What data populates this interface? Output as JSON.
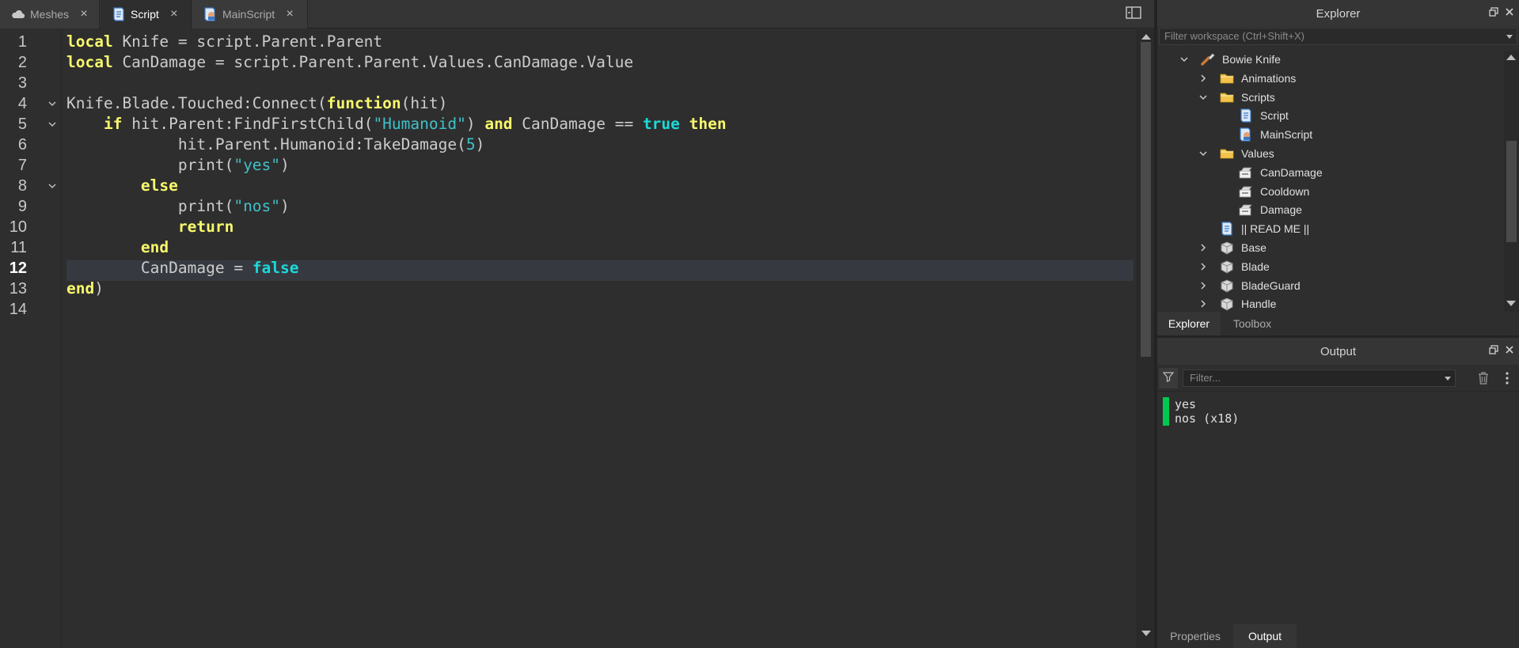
{
  "tabs": [
    {
      "label": "Meshes",
      "icon": "cloud-icon"
    },
    {
      "label": "Script",
      "icon": "script-icon"
    },
    {
      "label": "MainScript",
      "icon": "local-script-icon"
    }
  ],
  "editor": {
    "line_numbers": [
      "1",
      "2",
      "3",
      "4",
      "5",
      "6",
      "7",
      "8",
      "9",
      "10",
      "11",
      "12",
      "13",
      "14"
    ],
    "current_line": 12,
    "lines": [
      "local Knife = script.Parent.Parent",
      "local CanDamage = script.Parent.Parent.Values.CanDamage.Value",
      "",
      "Knife.Blade.Touched:Connect(function(hit)",
      "    if hit.Parent:FindFirstChild(\"Humanoid\") and CanDamage == true then",
      "            hit.Parent.Humanoid:TakeDamage(5)",
      "            print(\"yes\")",
      "        else",
      "            print(\"nos\")",
      "            return",
      "        end",
      "        CanDamage = false",
      "end)",
      ""
    ]
  },
  "explorer": {
    "title": "Explorer",
    "filter_placeholder": "Filter workspace (Ctrl+Shift+X)",
    "tree": [
      {
        "label": "Bowie Knife",
        "icon": "tool-icon",
        "level": 0,
        "expander": "expanded"
      },
      {
        "label": "Animations",
        "icon": "folder-icon",
        "level": 1,
        "expander": "collapsed"
      },
      {
        "label": "Scripts",
        "icon": "folder-icon",
        "level": 1,
        "expander": "expanded"
      },
      {
        "label": "Script",
        "icon": "script-icon",
        "level": 2,
        "expander": "none"
      },
      {
        "label": "MainScript",
        "icon": "local-script-icon",
        "level": 2,
        "expander": "none"
      },
      {
        "label": "Values",
        "icon": "folder-icon",
        "level": 1,
        "expander": "expanded"
      },
      {
        "label": "CanDamage",
        "icon": "value-icon",
        "level": 2,
        "expander": "none"
      },
      {
        "label": "Cooldown",
        "icon": "value-icon",
        "level": 2,
        "expander": "none"
      },
      {
        "label": "Damage",
        "icon": "value-icon",
        "level": 2,
        "expander": "none"
      },
      {
        "label": "|| READ ME ||",
        "icon": "script-icon",
        "level": 1,
        "expander": "none"
      },
      {
        "label": "Base",
        "icon": "mesh-part-icon",
        "level": 1,
        "expander": "collapsed"
      },
      {
        "label": "Blade",
        "icon": "mesh-part-icon",
        "level": 1,
        "expander": "collapsed"
      },
      {
        "label": "BladeGuard",
        "icon": "mesh-part-icon",
        "level": 1,
        "expander": "collapsed"
      },
      {
        "label": "Handle",
        "icon": "mesh-part-icon",
        "level": 1,
        "expander": "collapsed"
      }
    ],
    "bottom_tabs": [
      "Explorer",
      "Toolbox"
    ],
    "active_bottom_tab": "Explorer"
  },
  "output": {
    "title": "Output",
    "filter_placeholder": "Filter...",
    "messages": [
      "yes",
      "nos (x18)"
    ],
    "bottom_tabs": [
      "Properties",
      "Output"
    ],
    "active_bottom_tab": "Output"
  },
  "colors": {
    "keyword": "#f8f86d",
    "keyword_builtin": "#1cd9d9",
    "string": "#40c0c8",
    "output_bar": "#00c850"
  }
}
